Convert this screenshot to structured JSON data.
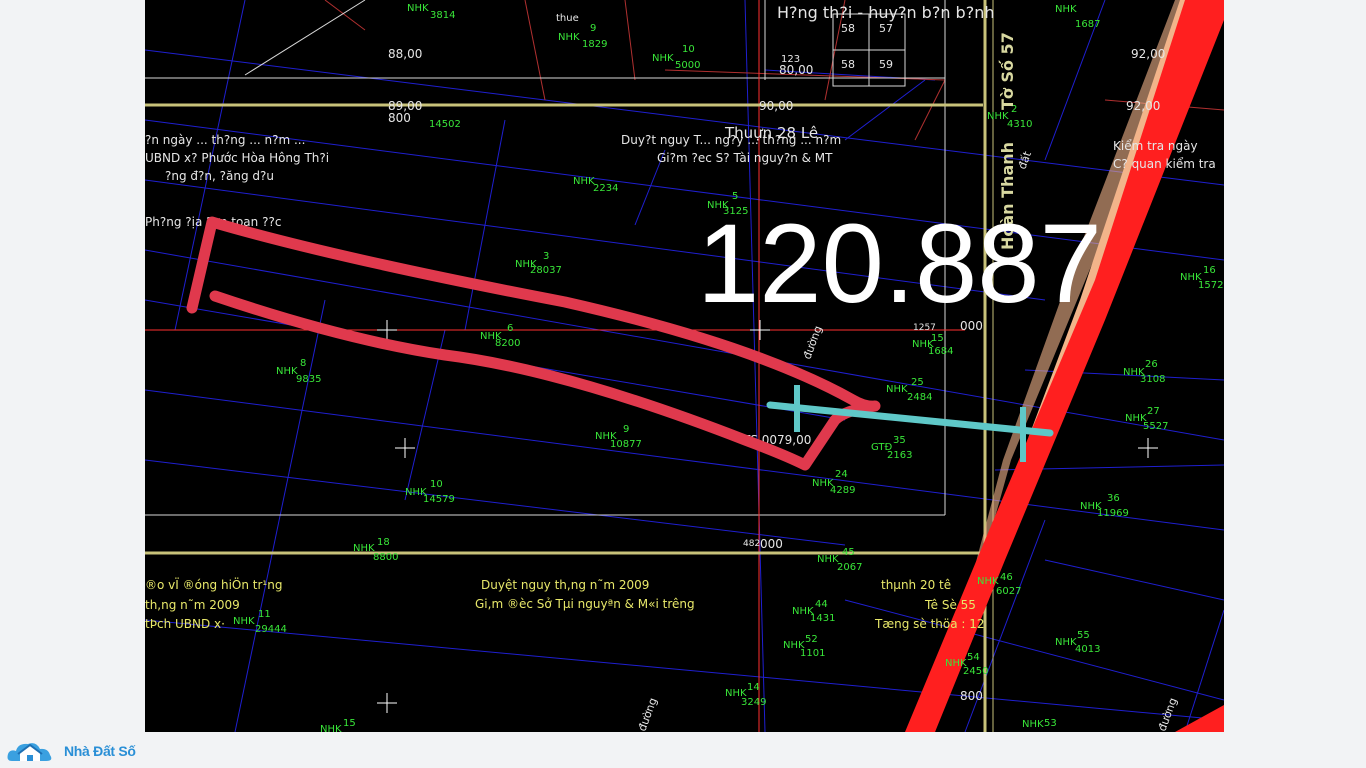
{
  "overlay": {
    "area_value": "120.887"
  },
  "brand": {
    "name": "Nhà Đất Số"
  },
  "colors": {
    "outline_stroke": "#e0394d",
    "measure_line": "#5fc8c8",
    "parcel_lines": "#1f1fd0",
    "road_red": "#ff1f1f",
    "road_tan": "#f2b48a",
    "grid_yellow": "#c8c27a",
    "label_green": "#39e639"
  },
  "parcels": [
    {
      "code": "NHK",
      "num": "3814"
    },
    {
      "code": "NHK",
      "num": "9",
      "area": "1829"
    },
    {
      "code": "NHK",
      "num": "10",
      "area": "5000"
    },
    {
      "code": "NHK",
      "num": "1",
      "area": "14502"
    },
    {
      "code": "NHK",
      "num": "2234"
    },
    {
      "code": "NHK",
      "num": "5",
      "area": "3125"
    },
    {
      "code": "NHK",
      "num": "3",
      "area": "28037"
    },
    {
      "code": "NHK",
      "num": "6",
      "area": "8200"
    },
    {
      "code": "NHK",
      "num": "8",
      "area": "9835"
    },
    {
      "code": "NHK",
      "num": "9",
      "area": "10877"
    },
    {
      "code": "NHK",
      "num": "10",
      "area": "14579"
    },
    {
      "code": "NHK",
      "num": "2",
      "area": "4310"
    },
    {
      "code": "NHK",
      "num": "15",
      "area": "1684"
    },
    {
      "code": "NHK",
      "num": "25",
      "area": "2484"
    },
    {
      "code": "NHK",
      "num": "24",
      "area": "4289"
    },
    {
      "code": "NHK",
      "num": "16",
      "area": "1572"
    },
    {
      "code": "NHK",
      "num": "26",
      "area": "3108"
    },
    {
      "code": "NHK",
      "num": "27",
      "area": "5527"
    },
    {
      "code": "NHK",
      "num": "36",
      "area": "11969"
    },
    {
      "code": "NHK",
      "num": "46",
      "area": "6027"
    },
    {
      "code": "NHK",
      "num": "44",
      "area": "1431"
    },
    {
      "code": "NHK",
      "num": "52",
      "area": "1101"
    },
    {
      "code": "NHK",
      "num": "55",
      "area": "4013"
    },
    {
      "code": "NHK",
      "num": "54",
      "area": "2450"
    },
    {
      "code": "NHK",
      "num": "14",
      "area": "3249"
    },
    {
      "code": "NHK",
      "num": "11",
      "area": "29444"
    },
    {
      "code": "NHK",
      "num": "53"
    },
    {
      "code": "NHK",
      "num": "45",
      "area": "2067"
    },
    {
      "code": "GTĐ",
      "num": "35",
      "area": "2163"
    },
    {
      "code": "NHK",
      "num": "18",
      "area": "8800"
    },
    {
      "code": "NHK",
      "num": "15"
    },
    {
      "code": "NHK",
      "num": "1687"
    }
  ],
  "texts": {
    "t1": "88,00",
    "t2": "80,00",
    "t3": "92,00",
    "t4": "92,00",
    "t5": "89,00",
    "t6": "800",
    "t7": "90,00",
    "t8": "H?ng th?i - huy?n b?n b?nh",
    "t9": "Thuựn 28 Lê",
    "t10": "Duy?t nguy T... ng?y ... th?ng ... n?m",
    "t11": "Gi?m ?ec S? Tài nguy?n & MT",
    "t12": "C? quan kiểm tra",
    "t13": "Kiểm tra ngày",
    "t14": "?n ngày ... th?ng ... n?m ...",
    "t15": "UBND x? Phước Hòa Hông Th?i",
    "t16": "?ng đ?n, ?ăng d?u",
    "t17": "Ph?ng ?ịa ?ợp toạn ??c",
    "t18": "Tờ Số 57",
    "t19": "Hoàn Thanh",
    "t20": "1257",
    "t21": "000",
    "t22": "482",
    "t23": "000",
    "t24": "800",
    "t25": "TS 0079,00",
    "t26": "thue",
    "t27": "Duyệt nguy    th,ng    n˜m 2009",
    "t28": "Gi,m ®èc Sở Tµi nguyªn & M«i tr­êng",
    "t29": "thµnh 20 tê",
    "t30": "Tê Sè 55",
    "t31": "Tæng sè thöa : 12",
    "t32": "®o vÏ ®óng hiÖn tr¹ng",
    "t33": "th,ng    n˜m 2009",
    "t34": "tÞch UBND x·",
    "t35": "58",
    "t36": "57",
    "t37": "58",
    "t38": "59",
    "t39": "123",
    "t40": "đường",
    "t41": "đường",
    "t42": "đường",
    "t43": "đất"
  }
}
